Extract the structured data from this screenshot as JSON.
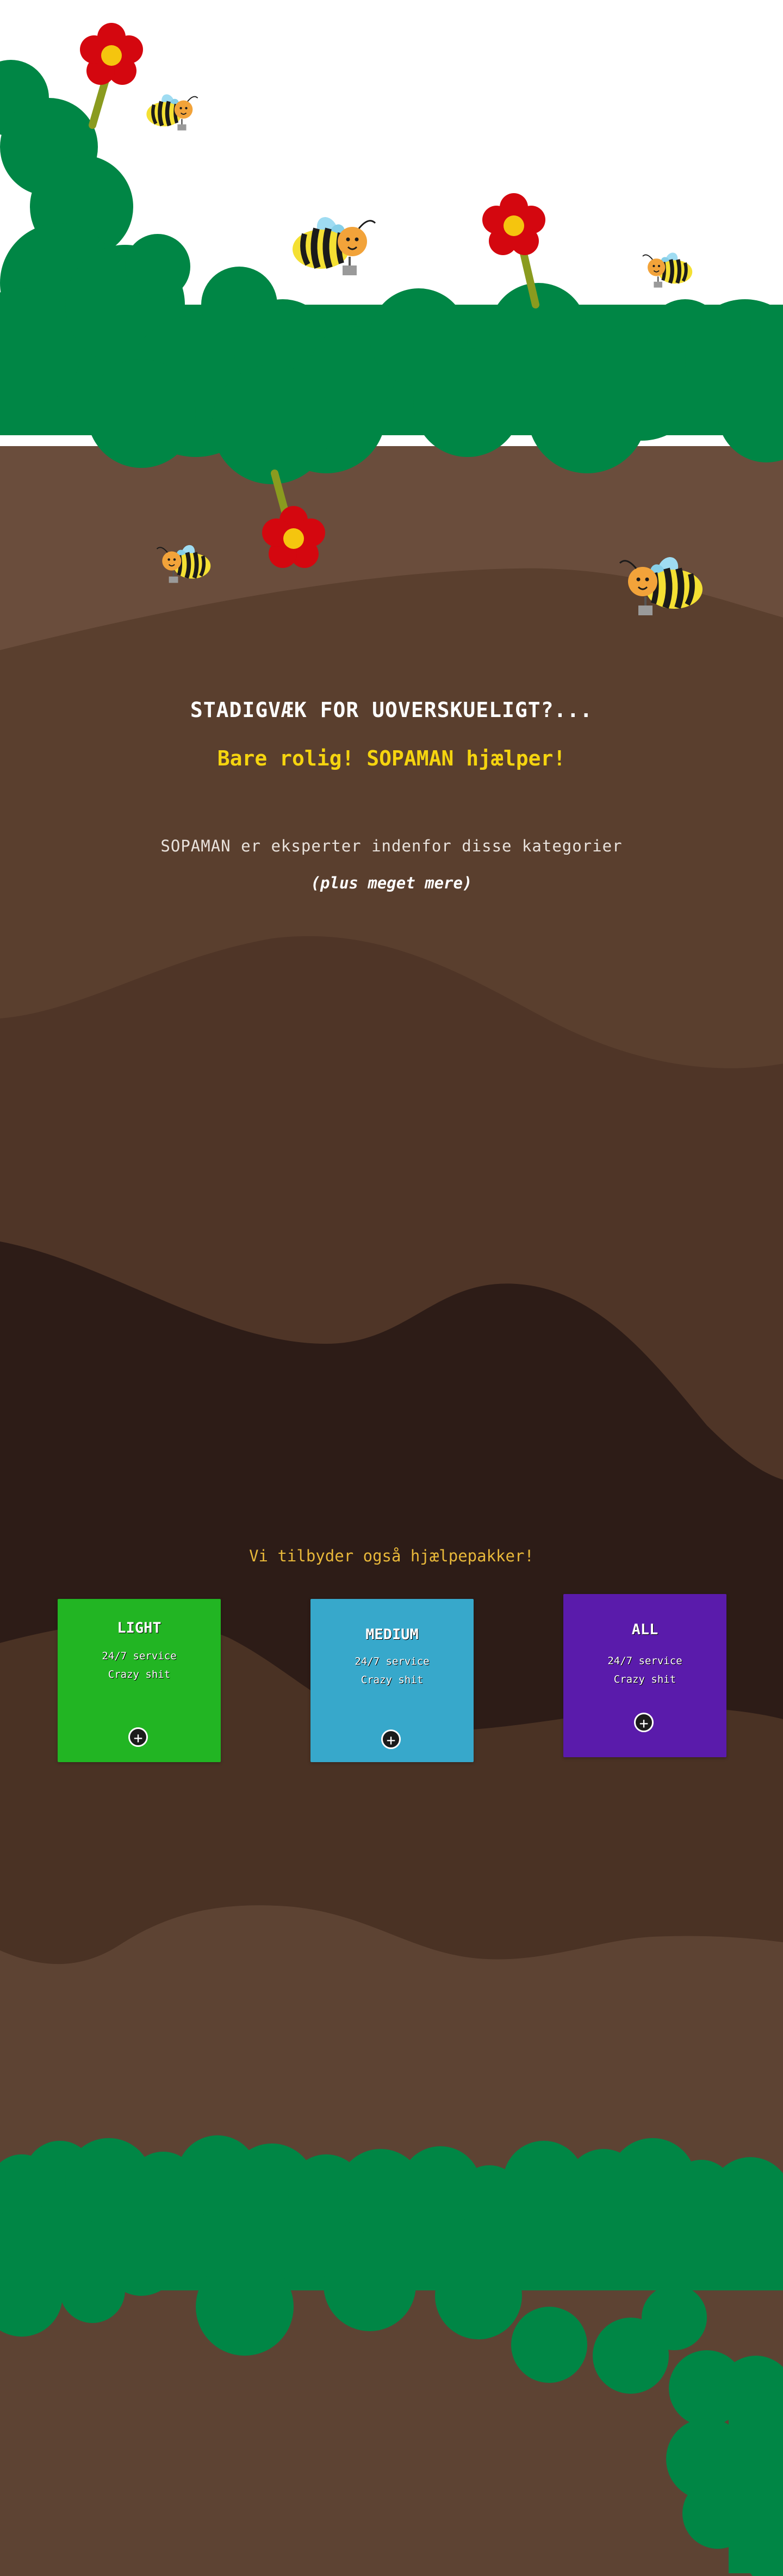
{
  "colors": {
    "foliage": "#008645",
    "soil_top": "#6a4d3c",
    "soil_mid": "#5a3f2e",
    "soil_dark": "#2d1c17",
    "card_light": "#22b523",
    "card_medium": "#37a8cb",
    "card_all": "#5a1bab",
    "highlight": "#f5d40f"
  },
  "hero": {
    "title": "STADIGVÆK FOR UOVERSKUELIGT?...",
    "subtitle": "Bare rolig! SOPAMAN hjælper!",
    "categories_text": "SOPAMAN er eksperter indenfor disse kategorier",
    "more_text": "(plus meget mere)"
  },
  "packages": {
    "heading": "Vi tilbyder også hjælpepakker!",
    "items": [
      {
        "name": "LIGHT",
        "feature1": "24/7 service",
        "feature2": "Crazy shit",
        "action_icon": "plus-circle-icon"
      },
      {
        "name": "MEDIUM",
        "feature1": "24/7 service",
        "feature2": "Crazy shit",
        "action_icon": "plus-circle-icon"
      },
      {
        "name": "ALL",
        "feature1": "24/7 service",
        "feature2": "Crazy shit",
        "action_icon": "plus-circle-icon"
      }
    ]
  },
  "decorations": [
    "bee-icon",
    "flower-icon",
    "bush-icon",
    "soil-layer"
  ]
}
